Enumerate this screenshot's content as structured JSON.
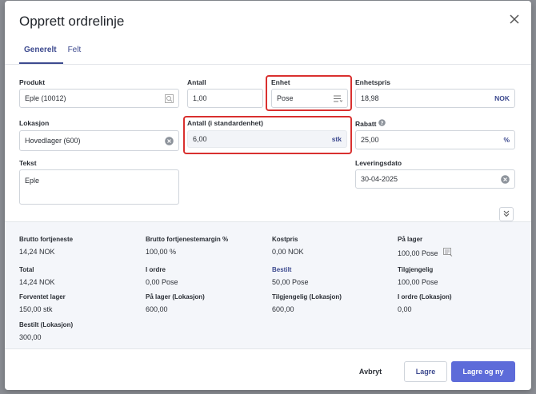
{
  "dialog": {
    "title": "Opprett ordrelinje"
  },
  "tabs": [
    {
      "label": "Generelt"
    },
    {
      "label": "Felt"
    }
  ],
  "form": {
    "produkt": {
      "label": "Produkt",
      "value": "Eple (10012)"
    },
    "antall": {
      "label": "Antall",
      "value": "1,00"
    },
    "enhet": {
      "label": "Enhet",
      "value": "Pose"
    },
    "enhetspris": {
      "label": "Enhetspris",
      "value": "18,98",
      "suffix": "NOK"
    },
    "lokasjon": {
      "label": "Lokasjon",
      "value": "Hovedlager (600)"
    },
    "antall_std": {
      "label": "Antall (i standardenhet)",
      "value": "6,00",
      "suffix": "stk"
    },
    "rabatt": {
      "label": "Rabatt",
      "value": "25,00",
      "suffix": "%"
    },
    "tekst": {
      "label": "Tekst",
      "value": "Eple"
    },
    "leveringsdato": {
      "label": "Leveringsdato",
      "value": "30-04-2025"
    }
  },
  "stats": [
    {
      "key": "Brutto fortjeneste",
      "value": "14,24 NOK"
    },
    {
      "key": "Brutto fortjenestemargin %",
      "value": "100,00 %"
    },
    {
      "key": "Kostpris",
      "value": "0,00 NOK"
    },
    {
      "key": "På lager",
      "value": "100,00 Pose"
    },
    {
      "key": "Total",
      "value": "14,24 NOK"
    },
    {
      "key": "I ordre",
      "value": "0,00 Pose"
    },
    {
      "key": "Bestilt",
      "value": "50,00 Pose"
    },
    {
      "key": "Tilgjengelig",
      "value": "100,00 Pose"
    },
    {
      "key": "Forventet lager",
      "value": "150,00 stk"
    },
    {
      "key": "På lager (Lokasjon)",
      "value": "600,00"
    },
    {
      "key": "Tilgjengelig (Lokasjon)",
      "value": "600,00"
    },
    {
      "key": "I ordre (Lokasjon)",
      "value": "0,00"
    },
    {
      "key": "Bestilt (Lokasjon)",
      "value": "300,00"
    }
  ],
  "footer": {
    "cancel": "Avbryt",
    "save": "Lagre",
    "save_new": "Lagre og ny"
  },
  "colors": {
    "accent": "#3d4a8f",
    "primary_button": "#5d6bd9",
    "highlight": "#d9302f"
  }
}
